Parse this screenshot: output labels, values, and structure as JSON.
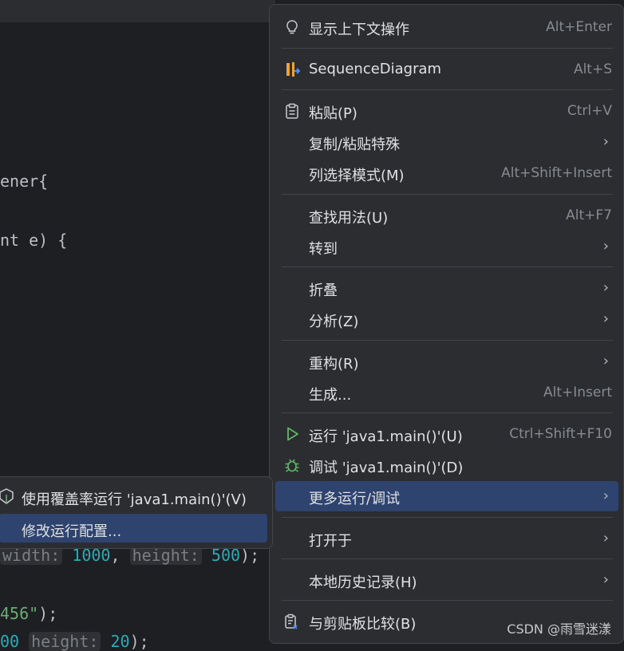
{
  "editor": {
    "lines": [
      {
        "text": "ener{"
      },
      {
        "text": "nt e) {"
      },
      {
        "prefix": "width:",
        "num1": "1000",
        "mid": ",",
        "hint2": "height:",
        "num2": "500",
        "suffix": ");"
      },
      {
        "str": "456\"",
        "suffix": ");"
      },
      {
        "num1": "00",
        "hint2": "height:",
        "num2": "20",
        "suffix": ");"
      }
    ]
  },
  "context_menu": {
    "items": [
      {
        "id": "show-context-actions",
        "label": "显示上下文操作",
        "shortcut": "Alt+Enter",
        "icon": "lightbulb-icon"
      },
      {
        "id": "sequence-diagram",
        "label": "SequenceDiagram",
        "shortcut": "Alt+S",
        "icon": "sequence-diagram-icon"
      },
      {
        "id": "paste",
        "label": "粘贴(P)",
        "shortcut": "Ctrl+V",
        "icon": "clipboard-icon"
      },
      {
        "id": "copy-paste-special",
        "label": "复制/粘贴特殊",
        "submenu": true
      },
      {
        "id": "column-selection-mode",
        "label": "列选择模式(M)",
        "shortcut": "Alt+Shift+Insert"
      },
      {
        "id": "find-usages",
        "label": "查找用法(U)",
        "shortcut": "Alt+F7"
      },
      {
        "id": "goto",
        "label": "转到",
        "submenu": true
      },
      {
        "id": "folding",
        "label": "折叠",
        "submenu": true
      },
      {
        "id": "analyze",
        "label": "分析(Z)",
        "submenu": true
      },
      {
        "id": "refactor",
        "label": "重构(R)",
        "submenu": true
      },
      {
        "id": "generate",
        "label": "生成...",
        "shortcut": "Alt+Insert"
      },
      {
        "id": "run",
        "label": "运行 'java1.main()'(U)",
        "shortcut": "Ctrl+Shift+F10",
        "icon": "run-icon"
      },
      {
        "id": "debug",
        "label": "调试 'java1.main()'(D)",
        "icon": "debug-icon"
      },
      {
        "id": "more-run-debug",
        "label": "更多运行/调试",
        "submenu": true,
        "highlighted": true
      },
      {
        "id": "open-in",
        "label": "打开于",
        "submenu": true
      },
      {
        "id": "local-history",
        "label": "本地历史记录(H)",
        "submenu": true
      },
      {
        "id": "compare-clipboard",
        "label": "与剪贴板比较(B)",
        "icon": "compare-clipboard-icon"
      }
    ],
    "arrow": "›"
  },
  "submenu": {
    "items": [
      {
        "label": "使用覆盖率运行 'java1.main()'(V)",
        "icon": "coverage-icon"
      },
      {
        "label": "修改运行配置...",
        "highlighted": true
      }
    ]
  },
  "watermark": "CSDN @雨雪迷漾",
  "colors": {
    "accent": "#2e436e",
    "run_green": "#5fb865",
    "menu_bg": "#2b2d30"
  }
}
